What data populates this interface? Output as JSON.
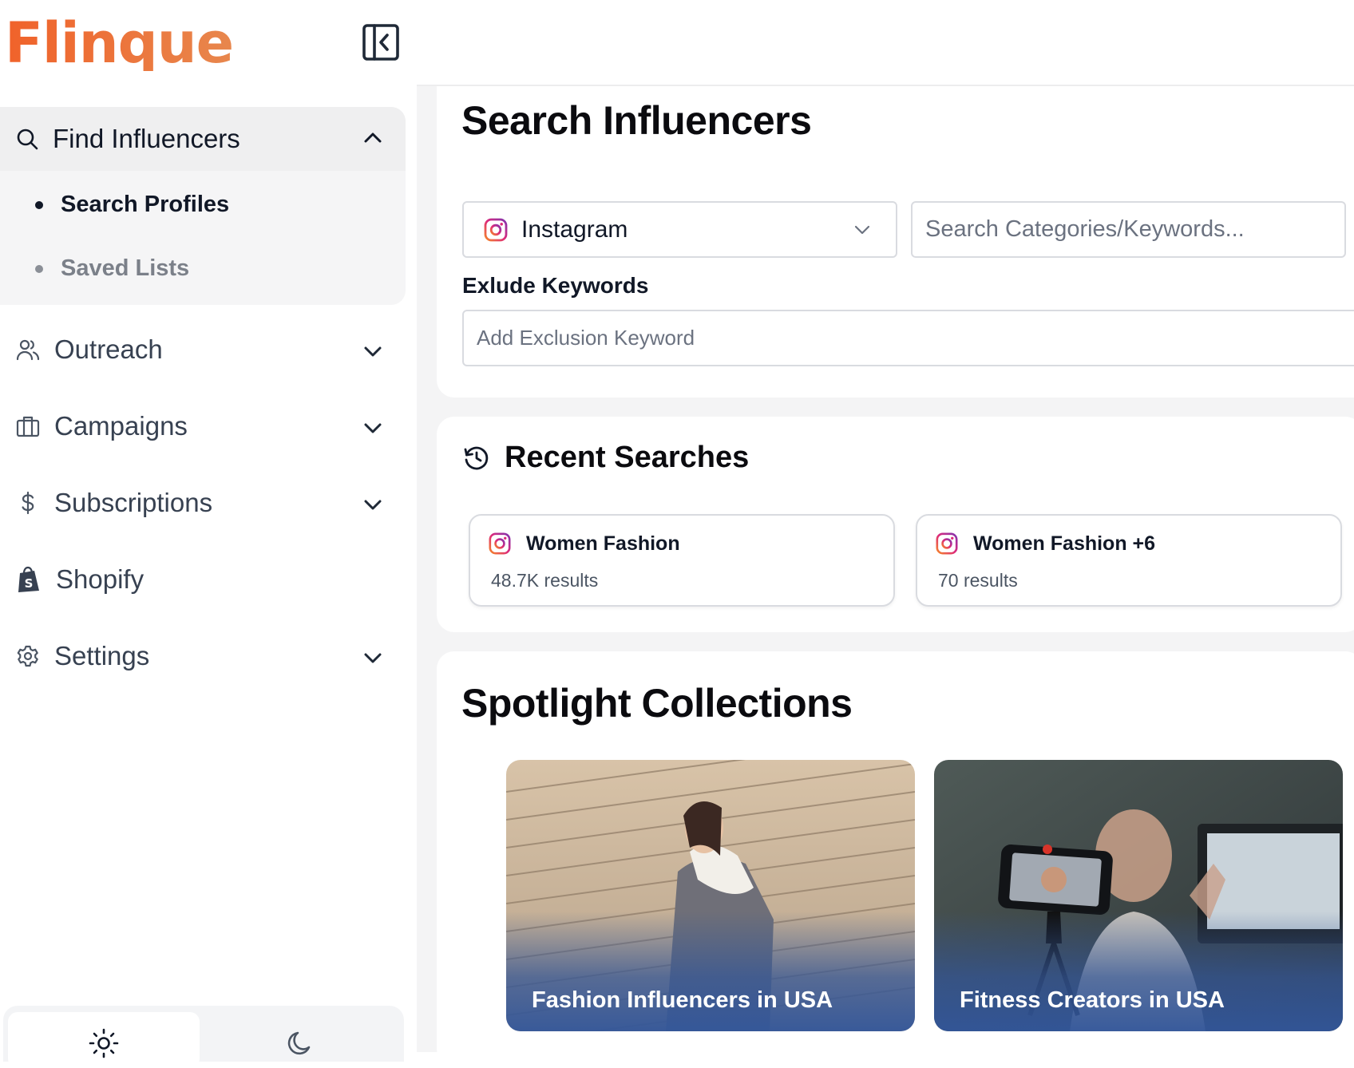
{
  "brand": {
    "name": "Flinque"
  },
  "sidebar": {
    "find": {
      "label": "Find Influencers",
      "items": [
        {
          "label": "Search Profiles"
        },
        {
          "label": "Saved Lists"
        }
      ]
    },
    "items": [
      {
        "label": "Outreach"
      },
      {
        "label": "Campaigns"
      },
      {
        "label": "Subscriptions"
      },
      {
        "label": "Shopify"
      },
      {
        "label": "Settings"
      }
    ]
  },
  "search": {
    "title": "Search Influencers",
    "platform": "Instagram",
    "keywords_placeholder": "Search Categories/Keywords...",
    "exclude_label": "Exlude Keywords",
    "exclude_placeholder": "Add Exclusion Keyword"
  },
  "recent": {
    "title": "Recent Searches",
    "items": [
      {
        "title": "Women Fashion",
        "sub": "48.7K results"
      },
      {
        "title": "Women Fashion +6",
        "sub": "70 results"
      }
    ]
  },
  "spotlight": {
    "title": "Spotlight Collections",
    "items": [
      {
        "caption": "Fashion Influencers in USA"
      },
      {
        "caption": "Fitness Creators in USA"
      }
    ]
  },
  "colors": {
    "brand_orange": "#f0622a",
    "instagram_gradient": [
      "#f58529",
      "#dd2a7b",
      "#8134af"
    ],
    "caption_overlay": "#34569a"
  }
}
